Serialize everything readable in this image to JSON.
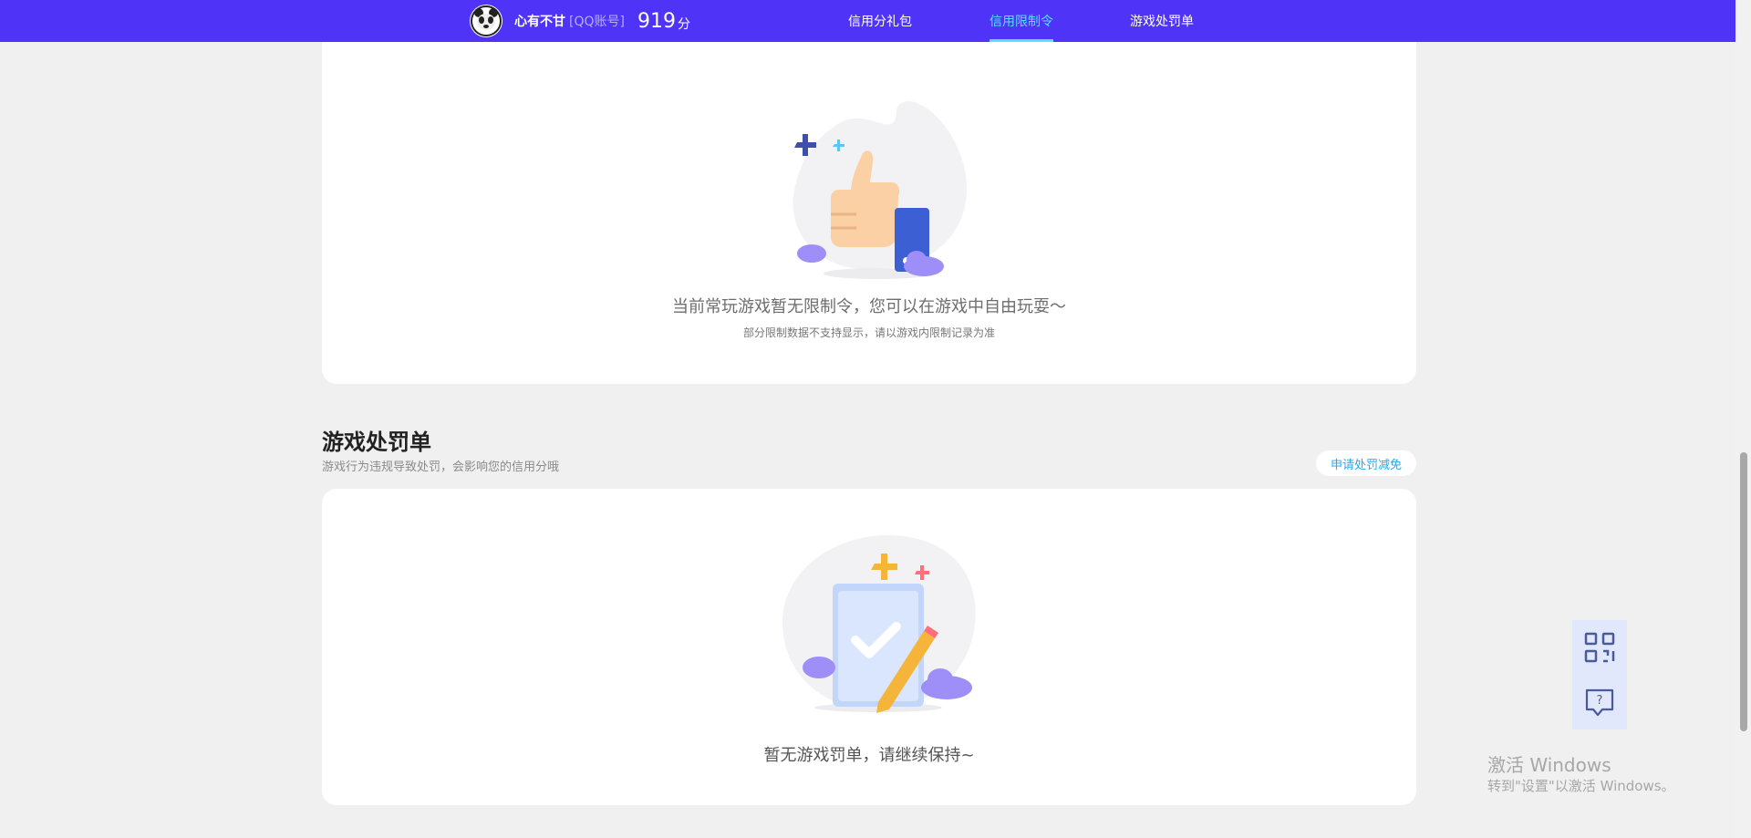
{
  "header": {
    "username": "心有不甘",
    "account_type": "[QQ账号]",
    "score": "919",
    "score_unit": "分",
    "nav": [
      {
        "label": "信用分礼包",
        "active": false
      },
      {
        "label": "信用限制令",
        "active": true
      },
      {
        "label": "游戏处罚单",
        "active": false
      }
    ]
  },
  "restriction": {
    "empty_title": "当前常玩游戏暂无限制令，您可以在游戏中自由玩耍～",
    "empty_note": "部分限制数据不支持显示，请以游戏内限制记录为准"
  },
  "penalty": {
    "title": "游戏处罚单",
    "description": "游戏行为违规导致处罚，会影响您的信用分哦",
    "appeal_button": "申请处罚减免",
    "empty_title": "暂无游戏罚单，请继续保持~"
  },
  "floating": {
    "qr_icon": "qr-code-icon",
    "help_icon": "help-chat-icon"
  },
  "watermark": {
    "line1": "激活 Windows",
    "line2": "转到\"设置\"以激活 Windows。"
  },
  "colors": {
    "header_bg": "#4f34f7",
    "nav_active": "#56e3ff",
    "link": "#2aa7e8",
    "page_bg": "#f0f0f0"
  }
}
